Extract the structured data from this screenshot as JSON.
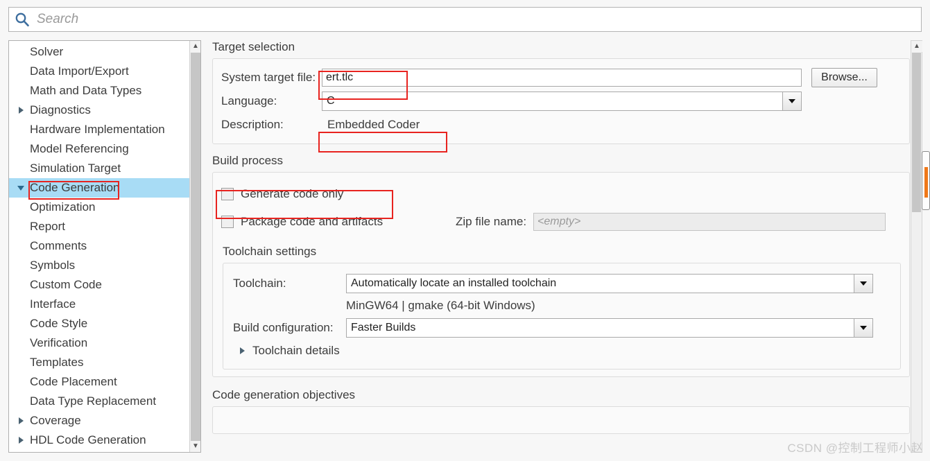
{
  "search": {
    "placeholder": "Search",
    "value": "",
    "icon": "search-icon"
  },
  "sidebar": {
    "items": [
      {
        "label": "Solver",
        "level": 0,
        "expander": "none",
        "selected": false
      },
      {
        "label": "Data Import/Export",
        "level": 0,
        "expander": "none",
        "selected": false
      },
      {
        "label": "Math and Data Types",
        "level": 0,
        "expander": "none",
        "selected": false
      },
      {
        "label": "Diagnostics",
        "level": 0,
        "expander": "collapsed",
        "selected": false
      },
      {
        "label": "Hardware Implementation",
        "level": 0,
        "expander": "none",
        "selected": false
      },
      {
        "label": "Model Referencing",
        "level": 0,
        "expander": "none",
        "selected": false
      },
      {
        "label": "Simulation Target",
        "level": 0,
        "expander": "none",
        "selected": false
      },
      {
        "label": "Code Generation",
        "level": 0,
        "expander": "expanded",
        "selected": true
      },
      {
        "label": "Optimization",
        "level": 1,
        "expander": "none",
        "selected": false
      },
      {
        "label": "Report",
        "level": 1,
        "expander": "none",
        "selected": false
      },
      {
        "label": "Comments",
        "level": 1,
        "expander": "none",
        "selected": false
      },
      {
        "label": "Symbols",
        "level": 1,
        "expander": "none",
        "selected": false
      },
      {
        "label": "Custom Code",
        "level": 1,
        "expander": "none",
        "selected": false
      },
      {
        "label": "Interface",
        "level": 1,
        "expander": "none",
        "selected": false
      },
      {
        "label": "Code Style",
        "level": 1,
        "expander": "none",
        "selected": false
      },
      {
        "label": "Verification",
        "level": 1,
        "expander": "none",
        "selected": false
      },
      {
        "label": "Templates",
        "level": 1,
        "expander": "none",
        "selected": false
      },
      {
        "label": "Code Placement",
        "level": 1,
        "expander": "none",
        "selected": false
      },
      {
        "label": "Data Type Replacement",
        "level": 1,
        "expander": "none",
        "selected": false
      },
      {
        "label": "Coverage",
        "level": 0,
        "expander": "collapsed",
        "selected": false
      },
      {
        "label": "HDL Code Generation",
        "level": 0,
        "expander": "collapsed",
        "selected": false
      }
    ],
    "selection_color": "#a8dcf5"
  },
  "target_selection": {
    "title": "Target selection",
    "system_target_file_label": "System target file:",
    "system_target_file_value": "ert.tlc",
    "browse_label": "Browse...",
    "language_label": "Language:",
    "language_value": "C",
    "description_label": "Description:",
    "description_value": "Embedded Coder"
  },
  "build_process": {
    "title": "Build process",
    "generate_code_only_label": "Generate code only",
    "generate_code_only_checked": false,
    "package_code_label": "Package code and artifacts",
    "package_code_checked": false,
    "zip_file_label": "Zip file name:",
    "zip_file_placeholder": "<empty>",
    "zip_file_value": ""
  },
  "toolchain_settings": {
    "title": "Toolchain settings",
    "toolchain_label": "Toolchain:",
    "toolchain_value": "Automatically locate an installed toolchain",
    "toolchain_info": "MinGW64 | gmake (64-bit Windows)",
    "build_config_label": "Build configuration:",
    "build_config_value": "Faster Builds",
    "toolchain_details_label": "Toolchain details",
    "toolchain_details_expanded": false
  },
  "objectives": {
    "title": "Code generation objectives"
  },
  "annotations": {
    "color": "#e8231f",
    "boxes": [
      "code-generation-tree-item",
      "system-target-file",
      "description-value",
      "generate-code-only"
    ]
  },
  "watermark": {
    "text": "CSDN @控制工程师小赵"
  }
}
